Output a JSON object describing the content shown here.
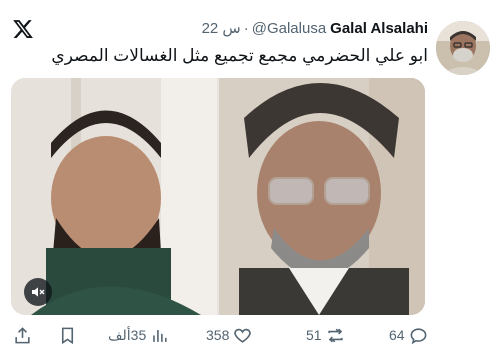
{
  "author": {
    "display_name": "Galal Alsalahi",
    "handle": "@Galalusa",
    "time": "22 س"
  },
  "tweet": {
    "text": "ابو علي الحضرمي مجمع تجميع مثل الغسالات المصري"
  },
  "media": {
    "type": "video",
    "mute_icon": "speaker-muted-icon"
  },
  "metrics": {
    "replies": "64",
    "reposts": "51",
    "likes": "358",
    "views": "35ألف"
  },
  "icons": {
    "logo": "x-logo-icon",
    "reply": "reply-icon",
    "repost": "repost-icon",
    "like": "heart-icon",
    "views": "views-chart-icon",
    "bookmark": "bookmark-icon",
    "share": "share-icon"
  },
  "colors": {
    "text_primary": "#0f1419",
    "text_secondary": "#536471",
    "background": "#ffffff"
  }
}
